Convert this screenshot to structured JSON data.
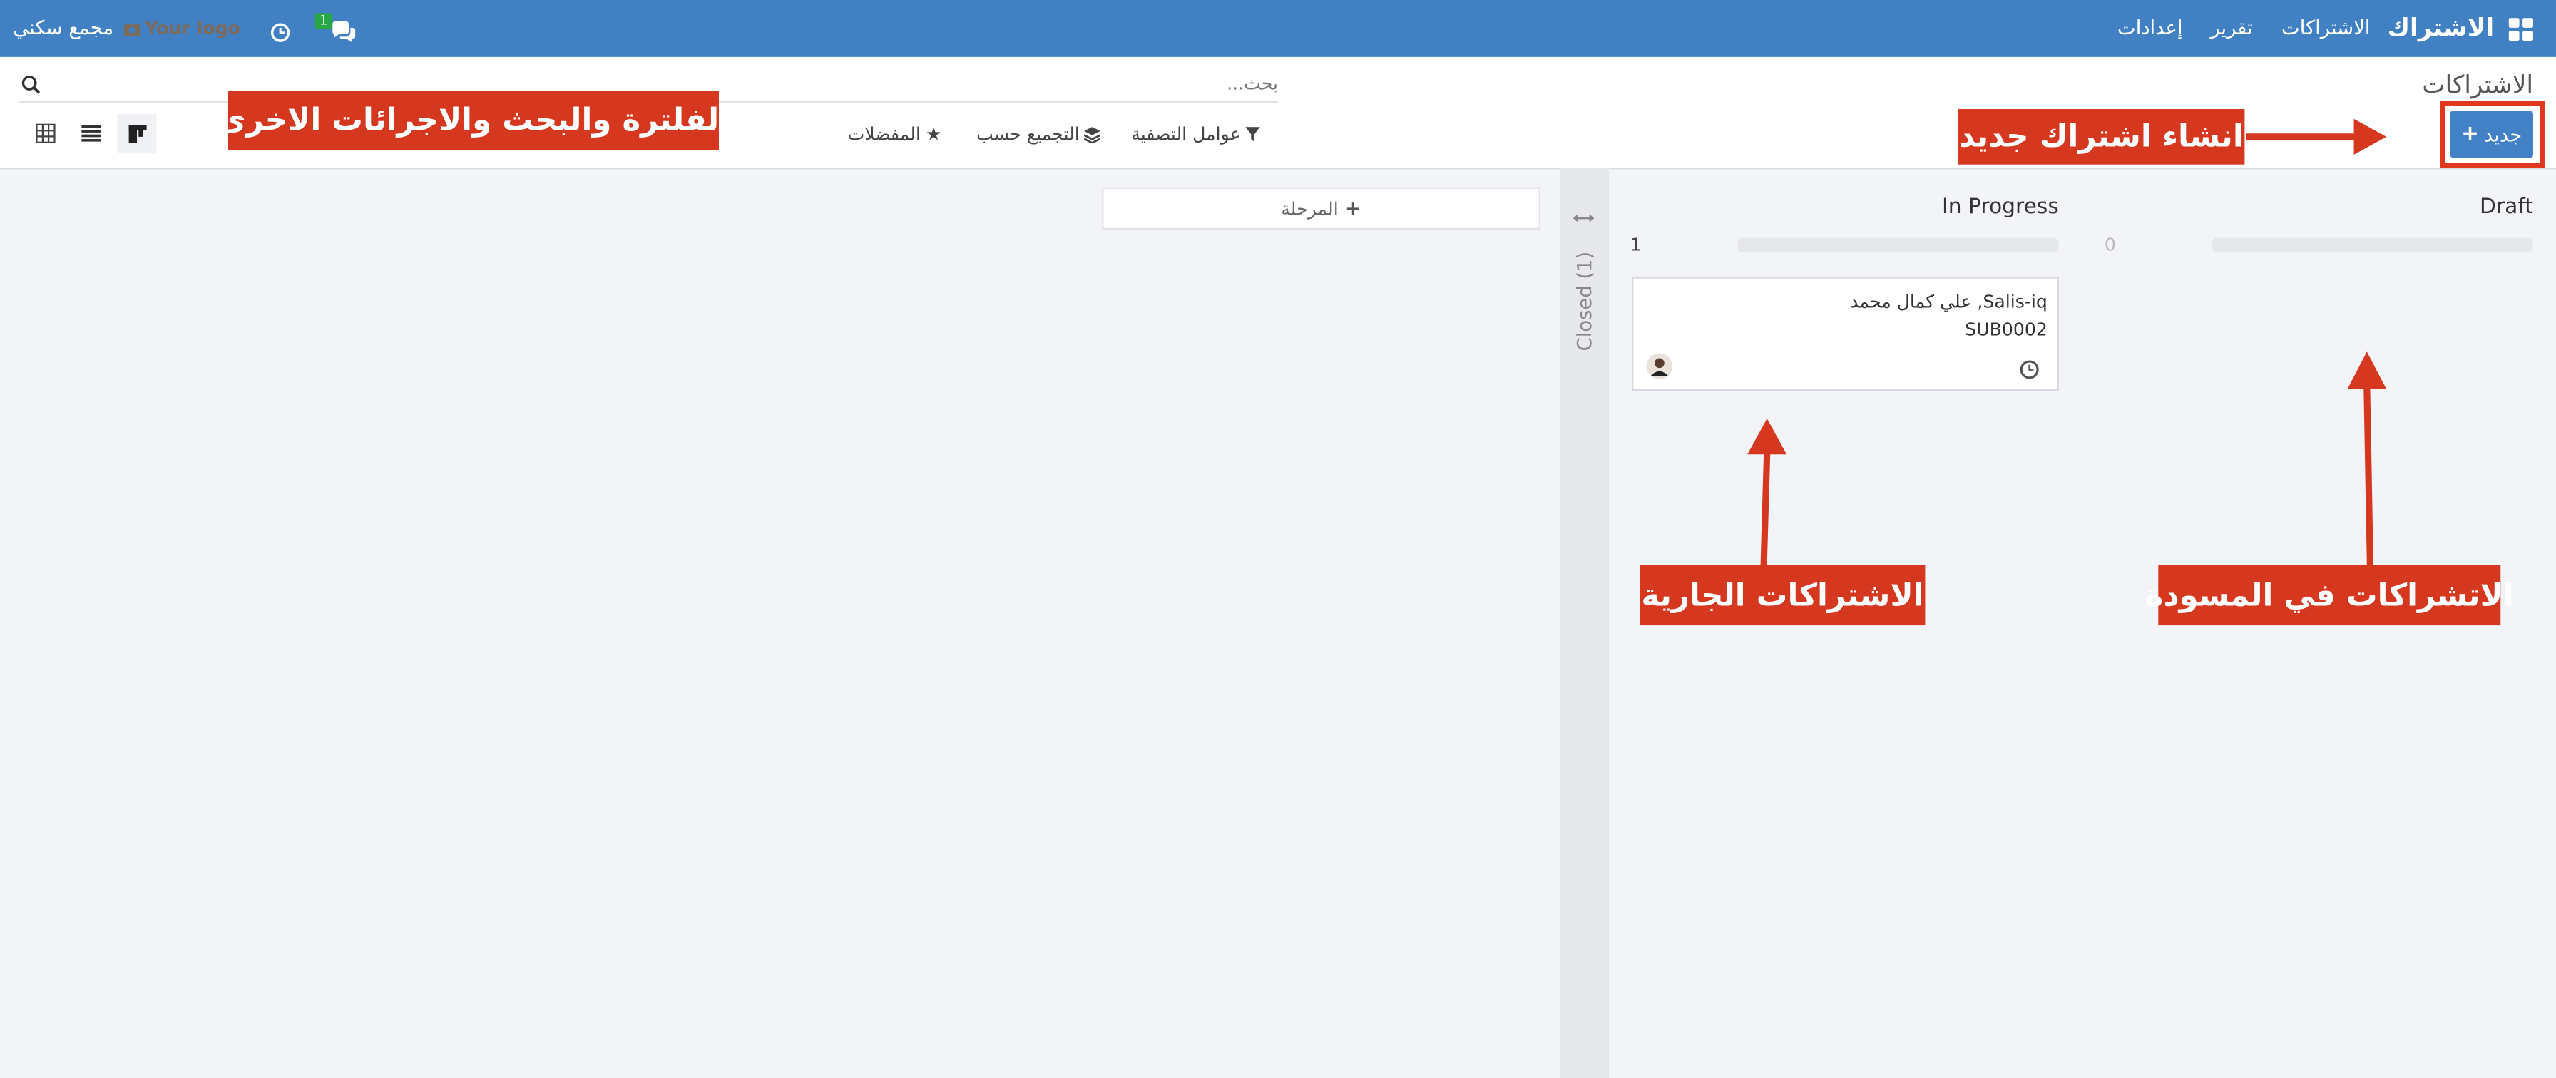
{
  "topbar": {
    "brand": "الاشتراك",
    "menu": [
      "الاشتراكات",
      "تقرير",
      "إعدادات"
    ],
    "messages_count": "1",
    "logo_label": "Your logo",
    "company": "مجمع سكني"
  },
  "control_panel": {
    "title": "الاشتراكات",
    "search_placeholder": "بحث...",
    "new_button": "جديد",
    "filters": "عوامل التصفية",
    "group_by": "التجميع حسب",
    "favorites": "المفضلات"
  },
  "annotations": {
    "create_new": "انشاء اشتراك جديد",
    "filter_search": "الفلترة والبحث والاجرائات الاخرى",
    "in_progress": "الاشتراكات الجارية",
    "draft": "الاتشراكات في المسودة"
  },
  "kanban": {
    "columns": [
      {
        "title": "Draft",
        "count": "0",
        "progress": 0
      },
      {
        "title": "In Progress",
        "count": "1",
        "progress": 0
      }
    ],
    "card": {
      "partner": "Salis-iq, علي كمال محمد",
      "code": "SUB0002"
    },
    "folded_column": "Closed (1)",
    "add_stage": "المرحلة"
  },
  "icons": [
    "apps-icon",
    "chat-icon",
    "clock-icon",
    "search-icon",
    "plus-icon",
    "filter-icon",
    "layers-icon",
    "star-icon",
    "kanban-view-icon",
    "list-view-icon",
    "grid-view-icon",
    "expand-icon",
    "avatar"
  ],
  "colors": {
    "navbar": "#4280c4",
    "primary": "#4281c5",
    "annotation": "#d5371f"
  }
}
